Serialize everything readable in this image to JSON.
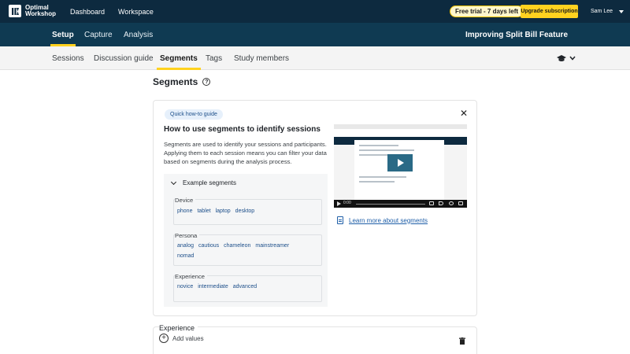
{
  "topbar": {
    "logo_line1": "Optimal",
    "logo_line2": "Workshop",
    "nav": [
      "Dashboard",
      "Workspace"
    ],
    "trial_badge": "Free trial - 7 days left",
    "upgrade_label": "Upgrade subscription",
    "user_name": "Sam Lee"
  },
  "secondary_nav": {
    "tabs": [
      "Setup",
      "Capture",
      "Analysis"
    ],
    "active": "Setup",
    "project_title": "Improving Split Bill Feature"
  },
  "sub_nav": {
    "tabs": [
      "Sessions",
      "Discussion guide",
      "Segments",
      "Tags",
      "Study members"
    ],
    "active": "Segments",
    "right_icon": "graduation-cap-icon"
  },
  "page": {
    "title": "Segments"
  },
  "guide_card": {
    "pill": "Quick how-to guide",
    "heading": "How to use segments to identify sessions",
    "paragraph": "Segments are used to identify your sessions and participants. Applying them to each session means you can filter your data based on segments during the analysis process.",
    "examples_header": "Example segments",
    "segments": [
      {
        "label": "Device",
        "values": [
          "phone",
          "tablet",
          "laptop",
          "desktop"
        ]
      },
      {
        "label": "Persona",
        "values": [
          "analog",
          "cautious",
          "chameleon",
          "mainstreamer",
          "nomad"
        ]
      },
      {
        "label": "Experience",
        "values": [
          "novice",
          "intermediate",
          "advanced"
        ]
      }
    ],
    "video_time": "0:00",
    "learn_more": "Learn more about segments"
  },
  "experience_card": {
    "label": "Experience",
    "add_values": "Add values"
  },
  "colors": {
    "topbar": "#0d2a3f",
    "secondary_bar": "#0f3a52",
    "accent_yellow": "#ffd21f",
    "link_blue": "#1f5fa8"
  }
}
